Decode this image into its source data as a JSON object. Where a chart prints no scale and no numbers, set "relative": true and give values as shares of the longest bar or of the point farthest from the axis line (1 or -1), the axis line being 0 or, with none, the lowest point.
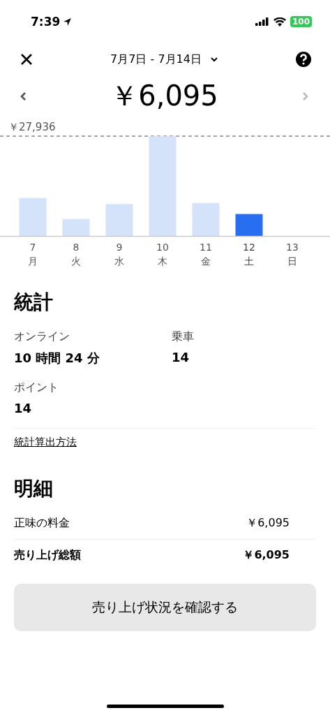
{
  "status_bar": {
    "time": "7:39",
    "battery": "100"
  },
  "header": {
    "date_range": "7月7日 - 7月14日"
  },
  "total": "￥6,095",
  "chart": {
    "max_label": "￥27,936",
    "chart_data": {
      "type": "bar",
      "categories": [
        "7",
        "8",
        "9",
        "10",
        "11",
        "12",
        "13"
      ],
      "values": [
        0.38,
        0.17,
        0.32,
        1,
        0.33,
        0.22,
        0
      ],
      "relative": true
    },
    "days": [
      {
        "weekday": "月",
        "selected": false
      },
      {
        "weekday": "火",
        "selected": false
      },
      {
        "weekday": "水",
        "selected": false
      },
      {
        "weekday": "木",
        "selected": false
      },
      {
        "weekday": "金",
        "selected": false
      },
      {
        "weekday": "土",
        "selected": true
      },
      {
        "weekday": "日",
        "selected": false
      }
    ]
  },
  "stats": {
    "title": "統計",
    "items": [
      {
        "label": "オンライン",
        "value": "10 時間 24 分"
      },
      {
        "label": "乗車",
        "value": "14"
      },
      {
        "label": "ポイント",
        "value": "14"
      }
    ],
    "link": "統計算出方法"
  },
  "details": {
    "title": "明細",
    "rows": [
      {
        "label": "正味の料金",
        "value": "￥6,095",
        "bold": false
      },
      {
        "label": "売り上げ総額",
        "value": "￥6,095",
        "bold": true
      }
    ]
  },
  "button": "売り上げ状況を確認する"
}
